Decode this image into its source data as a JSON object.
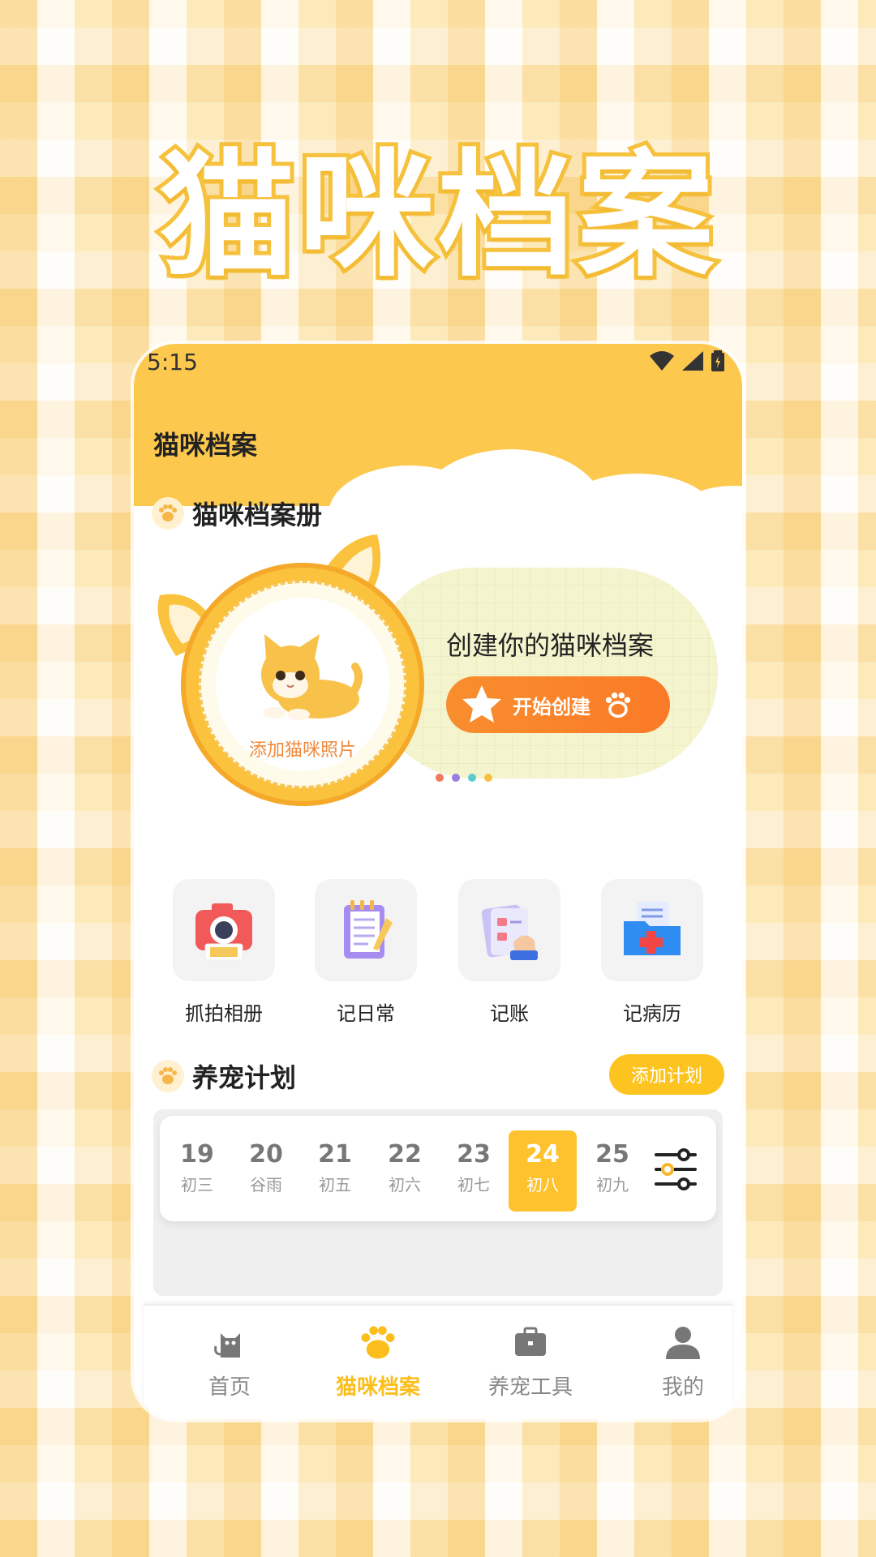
{
  "promo": {
    "title": "猫咪档案"
  },
  "status": {
    "time": "5:15"
  },
  "app": {
    "title": "猫咪档案"
  },
  "album": {
    "section_title": "猫咪档案册",
    "add_photo": "添加猫咪照片",
    "prompt": "创建你的猫咪档案",
    "create_button": "开始创建"
  },
  "quick_actions": [
    {
      "label": "抓拍相册",
      "icon": "camera-icon"
    },
    {
      "label": "记日常",
      "icon": "notebook-icon"
    },
    {
      "label": "记账",
      "icon": "ledger-icon"
    },
    {
      "label": "记病历",
      "icon": "medical-folder-icon"
    }
  ],
  "plan": {
    "section_title": "养宠计划",
    "add_button": "添加计划",
    "days": [
      {
        "num": "19",
        "lunar": "初三"
      },
      {
        "num": "20",
        "lunar": "谷雨"
      },
      {
        "num": "21",
        "lunar": "初五"
      },
      {
        "num": "22",
        "lunar": "初六"
      },
      {
        "num": "23",
        "lunar": "初七"
      },
      {
        "num": "24",
        "lunar": "初八",
        "active": true
      },
      {
        "num": "25",
        "lunar": "初九"
      }
    ]
  },
  "tabs": [
    {
      "label": "首页",
      "icon": "cat-icon"
    },
    {
      "label": "猫咪档案",
      "icon": "paw-icon",
      "active": true
    },
    {
      "label": "养宠工具",
      "icon": "toolbox-icon"
    },
    {
      "label": "我的",
      "icon": "user-icon"
    }
  ],
  "colors": {
    "brand": "#fdc84e",
    "accent": "#fa8a2c",
    "active_tab": "#fbbe1c"
  }
}
